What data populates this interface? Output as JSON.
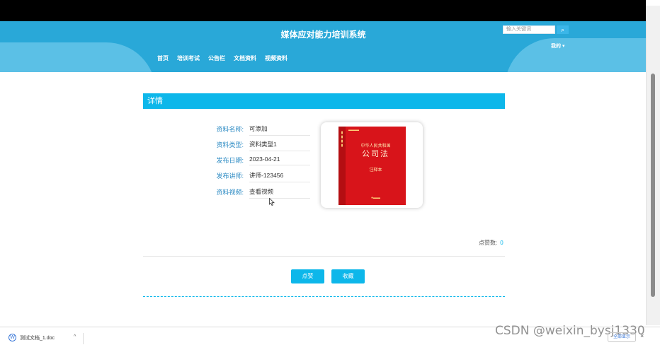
{
  "header": {
    "site_title": "媒体应对能力培训系统",
    "nav": [
      "首页",
      "培训考试",
      "公告栏",
      "文档资料",
      "视频资料"
    ],
    "search_placeholder": "输入关键词",
    "user_menu": "我的 ▾"
  },
  "detail": {
    "section_title": "详情",
    "fields": [
      {
        "label": "资料名称:",
        "value": "可添加"
      },
      {
        "label": "资料类型:",
        "value": "资料类型1"
      },
      {
        "label": "发布日期:",
        "value": "2023-04-21"
      },
      {
        "label": "发布讲师:",
        "value": "讲师-123456"
      },
      {
        "label": "资料视频:",
        "value": "查看视频"
      }
    ],
    "cover": {
      "sub": "中华人民共和国",
      "title": "公司法",
      "note": "注释本"
    },
    "likes_label": "点赞数:",
    "likes_count": "0",
    "like_button": "点赞",
    "favorite_button": "收藏"
  },
  "downloads": {
    "file_name": "测试文档_1.doc",
    "show_all": "全部显示"
  },
  "watermark": "CSDN @weixin_bysj1330",
  "colors": {
    "header": "#29a8d8",
    "accent": "#0db7ea",
    "label": "#2b8ac3"
  }
}
